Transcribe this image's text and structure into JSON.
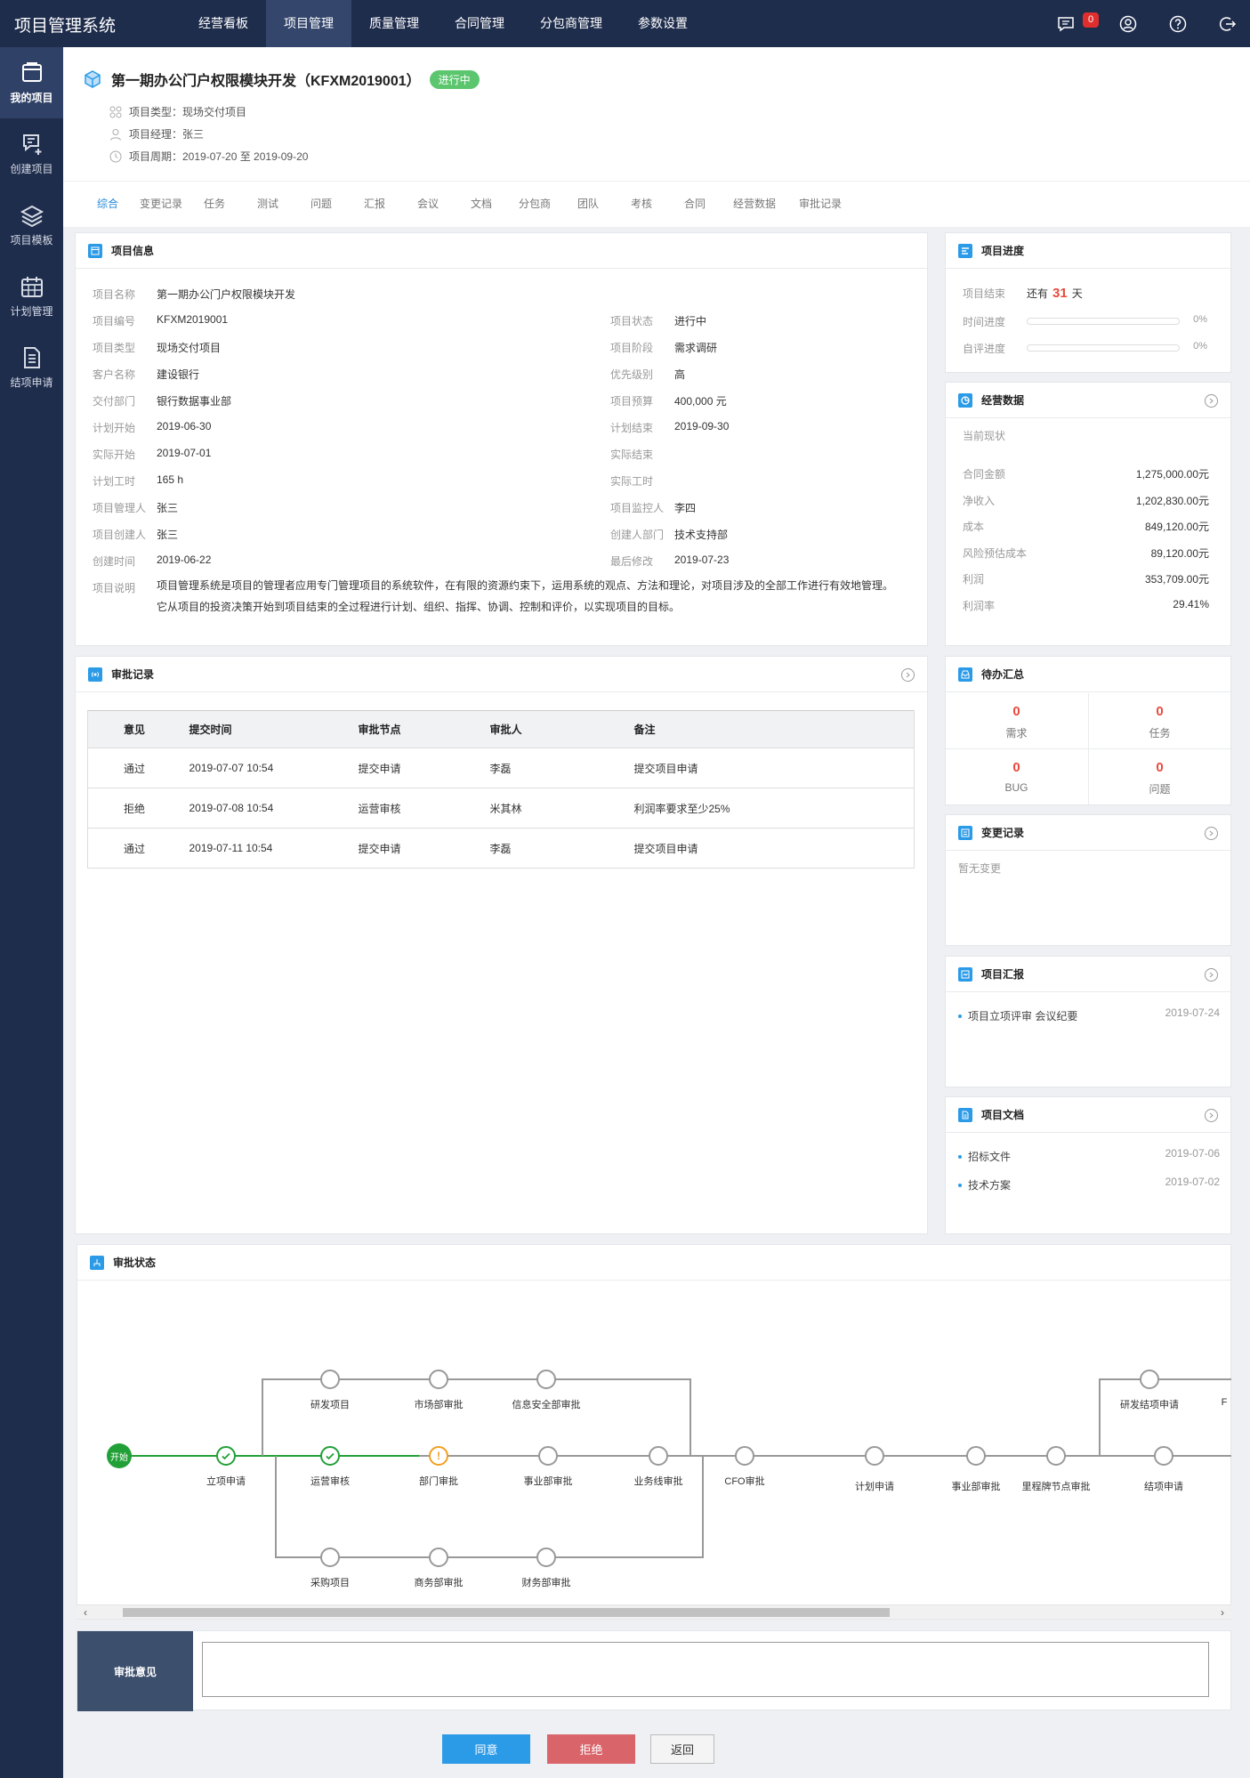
{
  "app": {
    "title": "项目管理系统"
  },
  "topnav": [
    "经营看板",
    "项目管理",
    "质量管理",
    "合同管理",
    "分包商管理",
    "参数设置"
  ],
  "notifications": {
    "count": "0"
  },
  "sidebar": [
    "我的项目",
    "创建项目",
    "项目模板",
    "计划管理",
    "结项申请"
  ],
  "project": {
    "title": "第一期办公门户权限模块开发（KFXM2019001）",
    "status": "进行中",
    "type_line": "项目类型：现场交付项目",
    "manager_line": "项目经理：张三",
    "period_line": "项目周期：2019-07-20 至 2019-09-20"
  },
  "tabs": [
    "综合",
    "变更记录",
    "任务",
    "测试",
    "问题",
    "汇报",
    "会议",
    "文档",
    "分包商",
    "团队",
    "考核",
    "合同",
    "经营数据",
    "审批记录"
  ],
  "info": {
    "title": "项目信息",
    "name_k": "项目名称",
    "name_v": "第一期办公门户权限模块开发",
    "left": [
      {
        "k": "项目编号",
        "v": "KFXM2019001"
      },
      {
        "k": "项目类型",
        "v": "现场交付项目"
      },
      {
        "k": "客户名称",
        "v": "建设银行"
      },
      {
        "k": "交付部门",
        "v": "银行数据事业部"
      },
      {
        "k": "计划开始",
        "v": "2019-06-30"
      },
      {
        "k": "实际开始",
        "v": "2019-07-01"
      },
      {
        "k": "计划工时",
        "v": "165 h"
      },
      {
        "k": "项目管理人",
        "v": "张三"
      },
      {
        "k": "项目创建人",
        "v": "张三"
      },
      {
        "k": "创建时间",
        "v": "2019-06-22"
      }
    ],
    "right": [
      {
        "k": "项目状态",
        "v": "进行中"
      },
      {
        "k": "项目阶段",
        "v": "需求调研"
      },
      {
        "k": "优先级别",
        "v": "高"
      },
      {
        "k": "项目预算",
        "v": "400,000 元"
      },
      {
        "k": "计划结束",
        "v": "2019-09-30"
      },
      {
        "k": "实际结束",
        "v": ""
      },
      {
        "k": "实际工时",
        "v": ""
      },
      {
        "k": "项目监控人",
        "v": "李四"
      },
      {
        "k": "创建人部门",
        "v": "技术支持部"
      },
      {
        "k": "最后修改",
        "v": "2019-07-23"
      }
    ],
    "desc_k": "项目说明",
    "desc_1": "项目管理系统是项目的管理者应用专门管理项目的系统软件，在有限的资源约束下，运用系统的观点、方法和理论，对项目涉及的全部工作进行有效地管理。",
    "desc_2": "它从项目的投资决策开始到项目结束的全过程进行计划、组织、指挥、协调、控制和评价，以实现项目的目标。"
  },
  "progress": {
    "title": "项目进度",
    "end_label": "项目结束",
    "end_prefix": "还有",
    "days": "31",
    "end_suffix": "天",
    "time_label": "时间进度",
    "time_value": "0%",
    "time_fraction": 0,
    "self_label": "自评进度",
    "self_value": "0%",
    "self_fraction": 0
  },
  "business": {
    "title": "经营数据",
    "subtitle": "当前现状",
    "rows": [
      {
        "k": "合同金额",
        "v": "1,275,000.00元"
      },
      {
        "k": "净收入",
        "v": "1,202,830.00元"
      },
      {
        "k": "成本",
        "v": "849,120.00元"
      },
      {
        "k": "风险预估成本",
        "v": "89,120.00元"
      },
      {
        "k": "利润",
        "v": "353,709.00元"
      },
      {
        "k": "利润率",
        "v": "29.41%"
      }
    ]
  },
  "approval": {
    "title": "审批记录",
    "headers": [
      "意见",
      "提交时间",
      "审批节点",
      "审批人",
      "备注"
    ],
    "rows": [
      [
        "通过",
        "2019-07-07  10:54",
        "提交申请",
        "李磊",
        "提交项目申请"
      ],
      [
        "拒绝",
        "2019-07-08  10:54",
        "运营审核",
        "米其林",
        "利润率要求至少25%"
      ],
      [
        "通过",
        "2019-07-11  10:54",
        "提交申请",
        "李磊",
        "提交项目申请"
      ]
    ]
  },
  "todo": {
    "title": "待办汇总",
    "items": [
      {
        "num": "0",
        "label": "需求"
      },
      {
        "num": "0",
        "label": "任务"
      },
      {
        "num": "0",
        "label": "BUG"
      },
      {
        "num": "0",
        "label": "问题"
      }
    ]
  },
  "changes": {
    "title": "变更记录",
    "empty": "暂无变更"
  },
  "reports": {
    "title": "项目汇报",
    "items": [
      {
        "name": "项目立项评审 会议纪要",
        "date": "2019-07-24"
      }
    ]
  },
  "docs": {
    "title": "项目文档",
    "items": [
      {
        "name": "招标文件",
        "date": "2019-07-06"
      },
      {
        "name": "技术方案",
        "date": "2019-07-02"
      }
    ]
  },
  "flow": {
    "title": "审批状态",
    "start": "开始",
    "nodes": {
      "n1": "立项申请",
      "n2": "运营审核",
      "n3": "部门审批",
      "n4": "事业部审批",
      "n5": "业务线审批",
      "n6": "CFO审批",
      "n7": "计划申请",
      "n8": "事业部审批",
      "n9": "里程牌节点审批",
      "n10": "结项申请",
      "t1": "研发项目",
      "t2": "市场部审批",
      "t3": "信息安全部审批",
      "b1": "采购项目",
      "b2": "商务部审批",
      "b3": "财务部审批",
      "r1": "研发结项申请",
      "r2": "F"
    },
    "colors": {
      "done": "#22a038",
      "current": "#f0a020",
      "pending": "#999999"
    }
  },
  "opinion": {
    "label": "审批意见",
    "placeholder": ""
  },
  "buttons": {
    "approve": "同意",
    "reject": "拒绝",
    "back": "返回"
  }
}
